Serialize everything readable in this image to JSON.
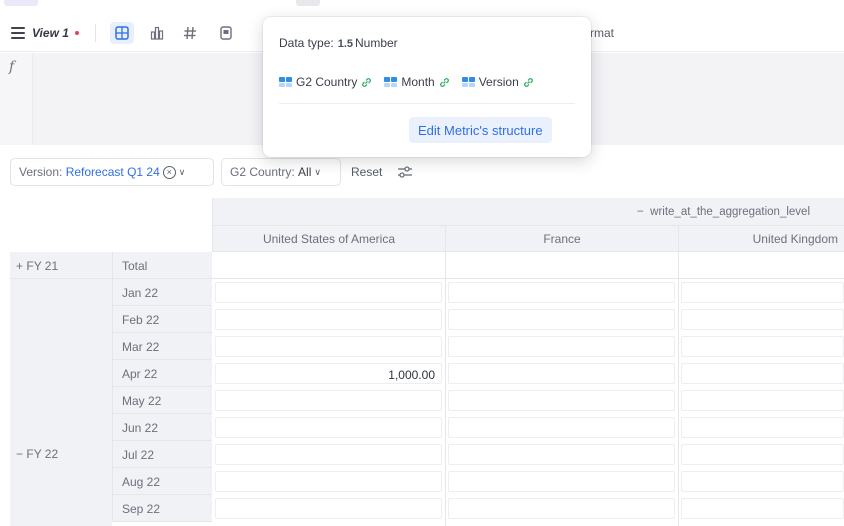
{
  "toolbar": {
    "view_name": "View 1",
    "format_label": "rmat"
  },
  "formula_bar": {
    "icon": "function-icon",
    "icon_glyph": "f"
  },
  "popover": {
    "data_type_label": "Data type:",
    "data_type_glyph": "1.5",
    "data_type_value": "Number",
    "dimensions": [
      {
        "label": "G2 Country"
      },
      {
        "label": "Month"
      },
      {
        "label": "Version"
      }
    ],
    "edit_button": "Edit Metric's structure"
  },
  "filters": {
    "version_label": "Version:",
    "version_value": "Reforecast Q1 24",
    "country_label": "G2 Country:",
    "country_value": "All",
    "reset_label": "Reset"
  },
  "grid": {
    "group_header": "write_at_the_aggregation_level",
    "group_toggle": "−",
    "columns": [
      "United States of America",
      "France",
      "United Kingdom"
    ],
    "fy21": {
      "toggle": "+",
      "label": "FY 21",
      "total_label": "Total"
    },
    "fy22": {
      "toggle": "−",
      "label": "FY 22"
    },
    "months": [
      "Jan 22",
      "Feb 22",
      "Mar 22",
      "Apr 22",
      "May 22",
      "Jun 22",
      "Jul 22",
      "Aug 22",
      "Sep 22"
    ],
    "values": {
      "apr_usa": "1,000.00"
    }
  },
  "colors": {
    "accent": "#2f6fe4",
    "header_bg": "#f1f2f5",
    "unsaved_dot": "#e0455d",
    "link_green": "#3bb06a"
  }
}
